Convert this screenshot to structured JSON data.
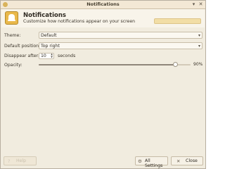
{
  "window": {
    "title": "Notifications",
    "controls": [
      "▾",
      "✕"
    ]
  },
  "header": {
    "title": "Notifications",
    "subtitle": "Customize how notifications appear on your screen",
    "search_value": ""
  },
  "form": {
    "theme_label": "Theme:",
    "theme_value": "Default",
    "position_label": "Default position:",
    "position_value": "Top right",
    "disappear_label": "Disappear after:",
    "disappear_value": "10",
    "disappear_unit": "seconds",
    "opacity_label": "Opacity:",
    "opacity_percent": 90,
    "opacity_text": "90%"
  },
  "buttons": {
    "help_label": "Help",
    "all_settings_label": "All Settings",
    "close_label": "Close"
  },
  "colors": {
    "window_bg": "#f1ecdf",
    "header_bg": "#f8f4ea",
    "accent": "#e9b84a",
    "search_bg": "#f2dea6"
  }
}
